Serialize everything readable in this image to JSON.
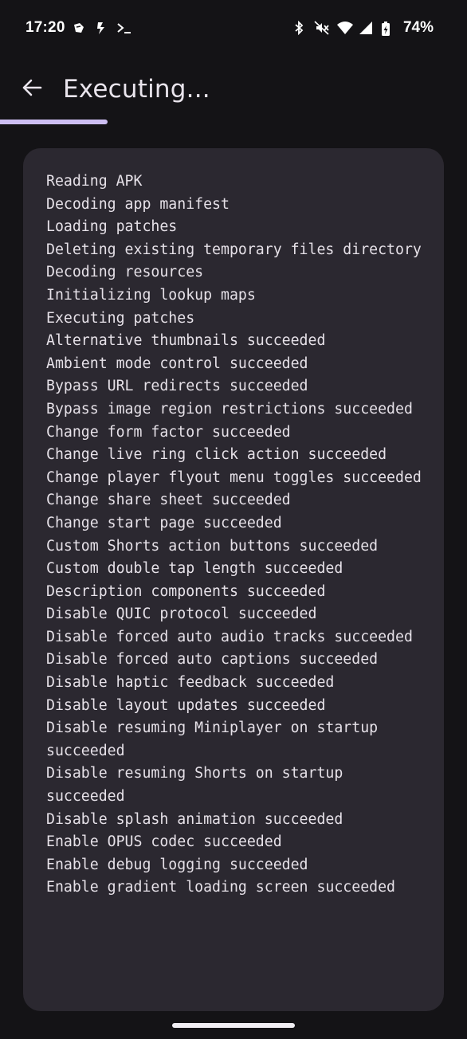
{
  "status_bar": {
    "time": "17:20",
    "battery": "74%",
    "left_icons": [
      "notification-icon",
      "app-icon",
      "terminal-icon"
    ],
    "right_icons": [
      "bluetooth-icon",
      "mute-icon",
      "wifi-icon",
      "signal-icon",
      "battery-charging-icon"
    ]
  },
  "app_bar": {
    "title": "Executing..."
  },
  "progress": {
    "fraction": 0.23,
    "color": "#cdbef2"
  },
  "colors": {
    "background": "#141316",
    "card": "#2b2830",
    "text": "#e6e1e8"
  },
  "log": [
    "Reading APK",
    "Decoding app manifest",
    "Loading patches",
    "Deleting existing temporary files directory",
    "Decoding resources",
    "Initializing lookup maps",
    "Executing patches",
    "Alternative thumbnails succeeded",
    "Ambient mode control succeeded",
    "Bypass URL redirects succeeded",
    "Bypass image region restrictions succeeded",
    "Change form factor succeeded",
    "Change live ring click action succeeded",
    "Change player flyout menu toggles succeeded",
    "Change share sheet succeeded",
    "Change start page succeeded",
    "Custom Shorts action buttons succeeded",
    "Custom double tap length succeeded",
    "Description components succeeded",
    "Disable QUIC protocol succeeded",
    "Disable forced auto audio tracks succeeded",
    "Disable forced auto captions succeeded",
    "Disable haptic feedback succeeded",
    "Disable layout updates succeeded",
    "Disable resuming Miniplayer on startup succeeded",
    "Disable resuming Shorts on startup succeeded",
    "Disable splash animation succeeded",
    "Enable OPUS codec succeeded",
    "Enable debug logging succeeded",
    "Enable gradient loading screen succeeded"
  ]
}
